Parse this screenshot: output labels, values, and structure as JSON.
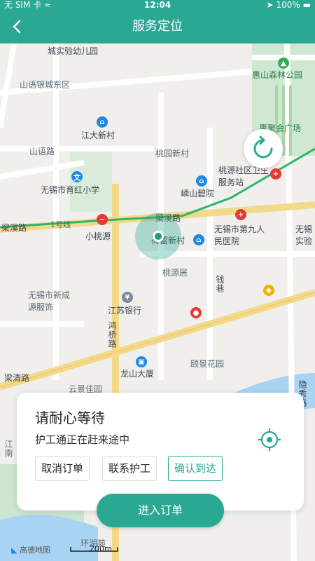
{
  "statusbar": {
    "carrier": "无 SIM 卡 ≈",
    "time": "12:04",
    "battery": "100%"
  },
  "header": {
    "title": "服务定位"
  },
  "map": {
    "labels": {
      "kindergarten": "城实验幼儿园",
      "shanyin_east": "山语银城东区",
      "huishan_park": "惠山森林公园",
      "juhui": "惠聚会广场",
      "jiangda": "江大新村",
      "shanyu_road": "山语路",
      "taoyuan": "桃园新村",
      "taoyuan_community": "桃源社区卫生服务站",
      "yuhong_school": "无锡市育红小学",
      "yuanbiyuan": "嶙山碧院",
      "liangxi_road_left": "梁溪路",
      "line1": "1号线",
      "xiaotaoyuan": "小桃源",
      "liangxi_road_mid": "梁溪路",
      "hospital_9": "无锡市第九人民医院",
      "wuxi_right": "无锡实验",
      "heleixincun": "荷蕾新村",
      "taoyuanju": "桃源居",
      "qianxiang": "钱巷",
      "chengyuan": "无锡市新成源服饰",
      "jiangsu_bank": "江苏银行",
      "hongqiao_road": "鸿桥路",
      "longshan": "龙山大厦",
      "yijing": "颐景花园",
      "liangqing_road": "梁清路",
      "yunjingjia": "云景佳园",
      "huanhu": "环湖苑",
      "right_vert": "隐秀路",
      "left_vert": "江南",
      "scale": "200m",
      "attribution": "高德地图"
    }
  },
  "card": {
    "title": "请耐心等待",
    "subtitle": "护工通正在赶来途中",
    "buttons": {
      "cancel": "取消订单",
      "contact": "联系护工",
      "confirm": "确认到达"
    }
  },
  "enter_button": "进入订单",
  "colors": {
    "primary": "#2aa892",
    "metro": "#2fb36b",
    "road_yellow": "#f3d98a"
  }
}
